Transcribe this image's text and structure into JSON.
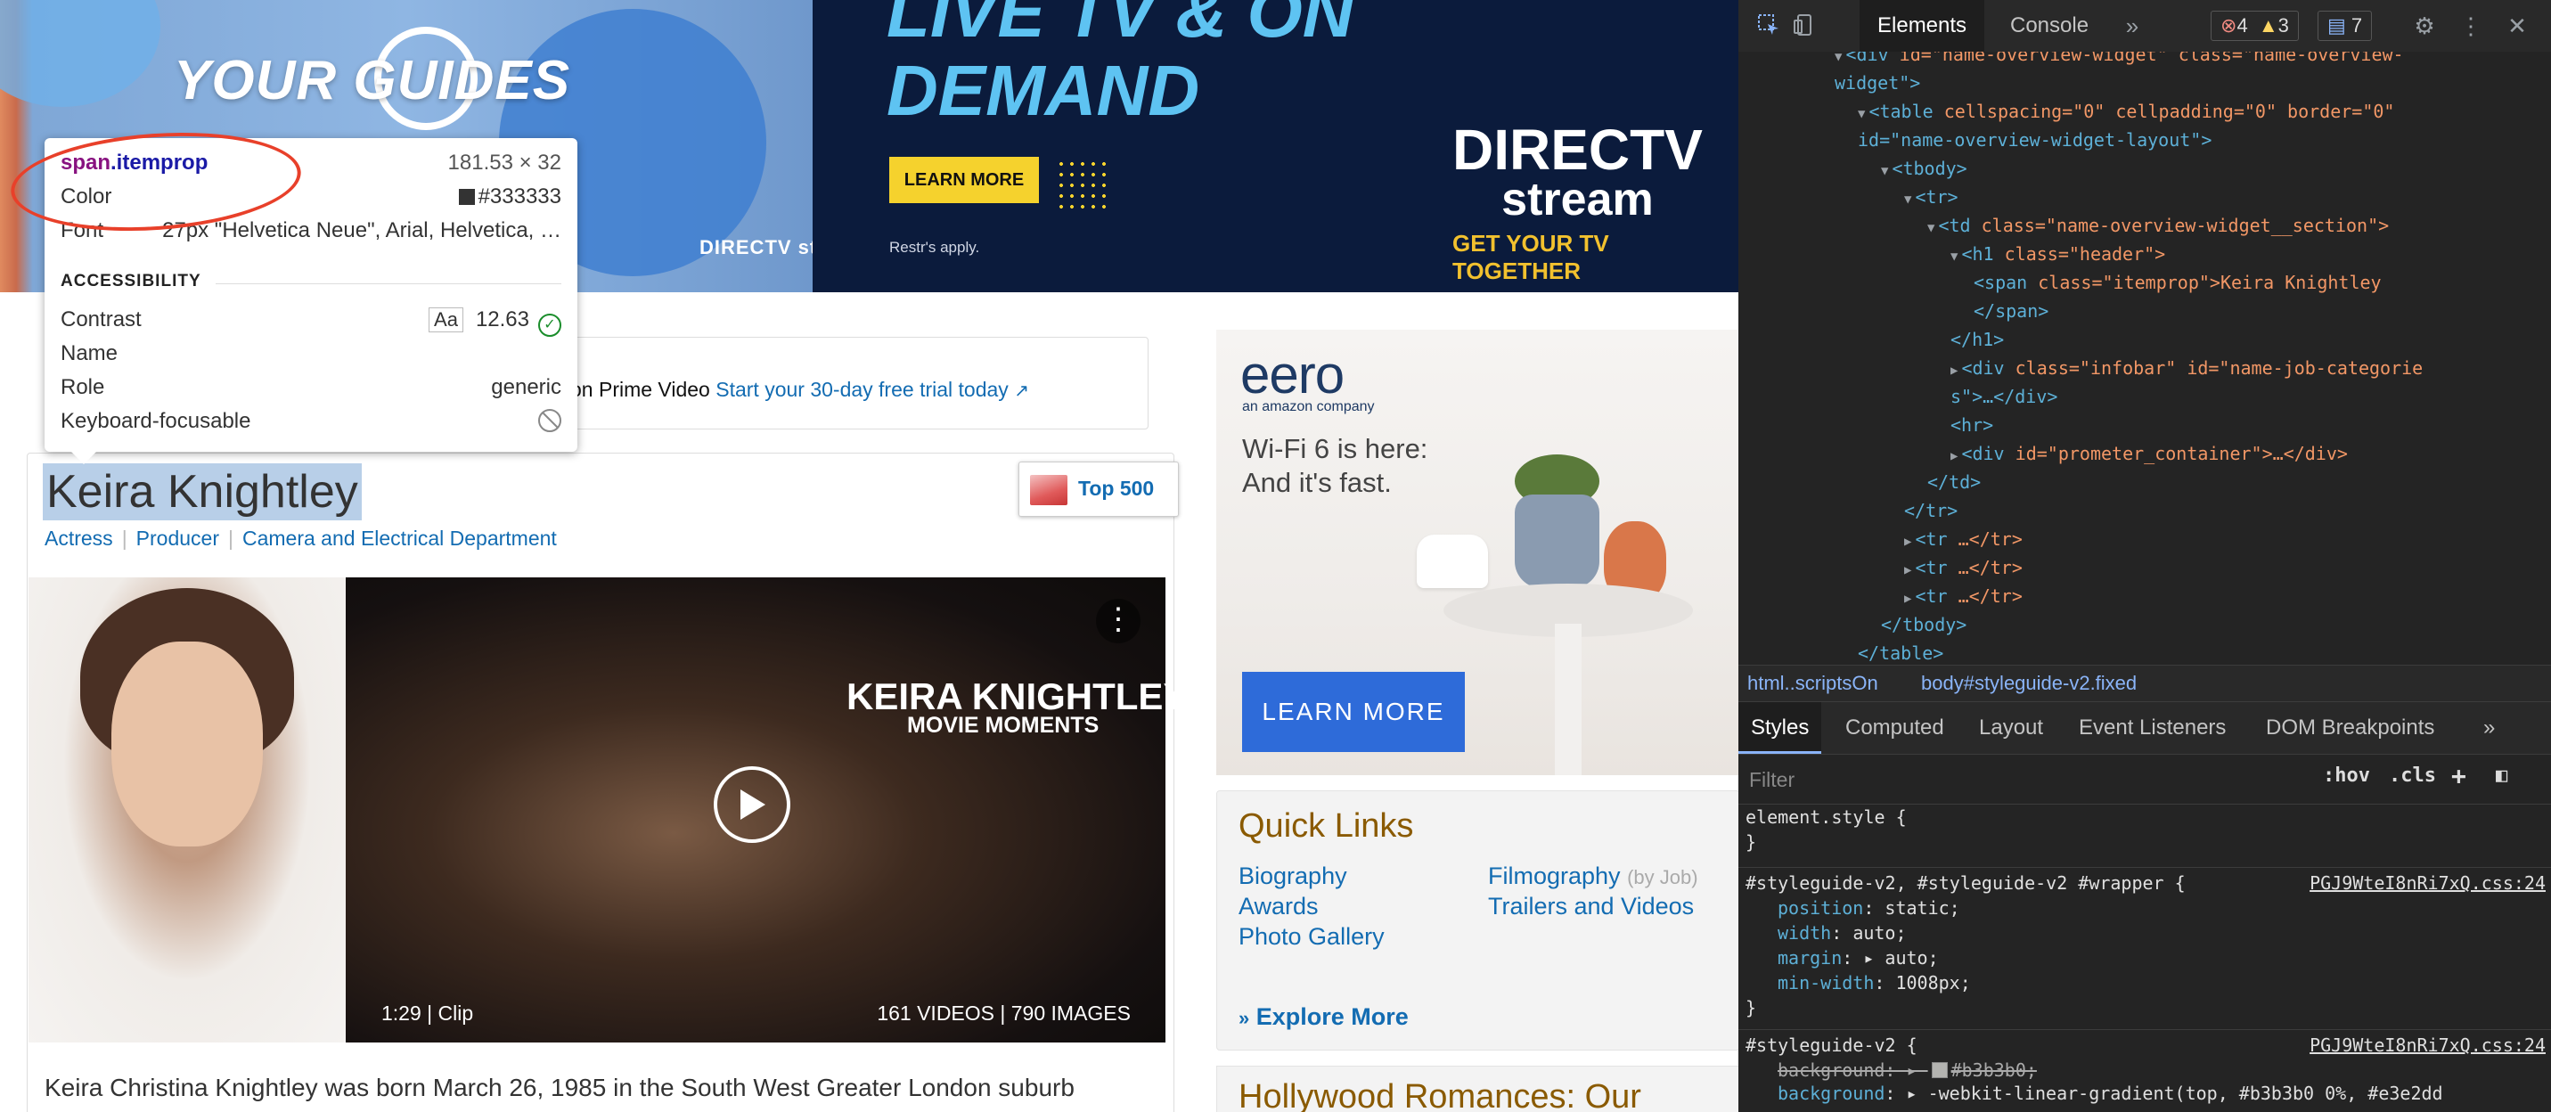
{
  "banner": {
    "left_brand": "YOUR GUIDES",
    "left_logo": "DIRECTV stream",
    "headline": "LIVE TV & ON DEMAND",
    "cta": "LEARN MORE",
    "restrictions": "Restr's apply.",
    "logo_line1": "DIRECTV",
    "logo_line2": "stream",
    "tagline": "GET YOUR TV TOGETHER"
  },
  "prime": {
    "text": "on Prime Video",
    "link": "Start your 30-day free trial today"
  },
  "profile": {
    "name": "Keira Knightley",
    "jobs": [
      "Actress",
      "Producer",
      "Camera and Electrical Department"
    ],
    "top_badge": "Top 500",
    "video_title": "KEIRA KNIGHTLEY",
    "video_subtitle": "MOVIE MOMENTS",
    "clip_info": "1:29 | Clip",
    "media_counts": "161 VIDEOS | 790 IMAGES",
    "bio": "Keira Christina Knightley was born March 26, 1985 in the South West Greater London suburb"
  },
  "tooltip": {
    "selector_tag": "span",
    "selector_class": ".itemprop",
    "size": "181.53 × 32",
    "color_label": "Color",
    "color_value": "#333333",
    "font_label": "Font",
    "font_value": "27px \"Helvetica Neue\", Arial, Helvetica, …",
    "accessibility_heading": "ACCESSIBILITY",
    "contrast_label": "Contrast",
    "contrast_aa": "Aa",
    "contrast_value": "12.63",
    "name_label": "Name",
    "role_label": "Role",
    "role_value": "generic",
    "focus_label": "Keyboard-focusable"
  },
  "sidebar": {
    "eero_logo": "eero",
    "eero_sub": "an amazon company",
    "eero_copy_1": "Wi-Fi 6 is here:",
    "eero_copy_2": "And it's fast.",
    "eero_cta": "LEARN MORE",
    "quick_links_title": "Quick Links",
    "links": {
      "biography": "Biography",
      "awards": "Awards",
      "photo_gallery": "Photo Gallery",
      "filmography": "Filmography",
      "by_job": "(by Job)",
      "trailers": "Trailers and Videos"
    },
    "explore_more": "Explore More",
    "next_title": "Hollywood Romances: Our"
  },
  "devtools": {
    "tabs": [
      "Elements",
      "Console"
    ],
    "errors": "4",
    "warnings": "3",
    "messages": "7",
    "dom_lines": [
      {
        "indent": 0,
        "tri": "▼",
        "tag": "div",
        "attrs": "id=\"name-overview-widget\" class=\"name-overview-"
      },
      {
        "indent": 0,
        "tri": "",
        "tag": "",
        "attrs": "widget\">"
      },
      {
        "indent": 1,
        "tri": "▼",
        "tag": "table",
        "attrs": "cellspacing=\"0\" cellpadding=\"0\" border=\"0\""
      },
      {
        "indent": 1,
        "tri": "",
        "tag": "",
        "attrs": "id=\"name-overview-widget-layout\">"
      },
      {
        "indent": 2,
        "tri": "▼",
        "tag": "tbody",
        "attrs": ""
      },
      {
        "indent": 3,
        "tri": "▼",
        "tag": "tr",
        "attrs": ""
      },
      {
        "indent": 4,
        "tri": "▼",
        "tag": "td",
        "attrs": "class=\"name-overview-widget__section\">"
      },
      {
        "indent": 5,
        "tri": "▼",
        "tag": "h1",
        "attrs": "class=\"header\">"
      },
      {
        "indent": 6,
        "tri": "",
        "tag": "span",
        "attrs": "class=\"itemprop\">Keira Knightley"
      },
      {
        "indent": 6,
        "tri": "",
        "tag": "",
        "attrs": "</span>"
      },
      {
        "indent": 5,
        "tri": "",
        "tag": "",
        "attrs": "</h1>"
      },
      {
        "indent": 5,
        "tri": "▶",
        "tag": "div",
        "attrs": "class=\"infobar\" id=\"name-job-categorie"
      },
      {
        "indent": 5,
        "tri": "",
        "tag": "",
        "attrs": "s\">…</div>"
      },
      {
        "indent": 5,
        "tri": "",
        "tag": "hr",
        "attrs": ""
      },
      {
        "indent": 5,
        "tri": "▶",
        "tag": "div",
        "attrs": "id=\"prometer_container\">…</div>"
      },
      {
        "indent": 4,
        "tri": "",
        "tag": "",
        "attrs": "</td>"
      },
      {
        "indent": 3,
        "tri": "",
        "tag": "",
        "attrs": "</tr>"
      },
      {
        "indent": 3,
        "tri": "▶",
        "tag": "tr",
        "attrs": "…</tr>"
      },
      {
        "indent": 3,
        "tri": "▶",
        "tag": "tr",
        "attrs": "…</tr>"
      },
      {
        "indent": 3,
        "tri": "▶",
        "tag": "tr",
        "attrs": "…</tr>"
      },
      {
        "indent": 2,
        "tri": "",
        "tag": "",
        "attrs": "</tbody>"
      },
      {
        "indent": 1,
        "tri": "",
        "tag": "",
        "attrs": "</table>"
      },
      {
        "indent": 0,
        "tri": "",
        "tag": "",
        "attrs": "</div>"
      }
    ],
    "breadcrumbs": [
      "html..scriptsOn",
      "body#styleguide-v2.fixed"
    ],
    "panel_tabs": [
      "Styles",
      "Computed",
      "Layout",
      "Event Listeners",
      "DOM Breakpoints"
    ],
    "filter_placeholder": "Filter",
    "hov": ":hov",
    "cls": ".cls",
    "css": {
      "element_style": "element.style {",
      "close": "}",
      "rule1_selector": "#styleguide-v2, #styleguide-v2 #wrapper {",
      "rule1_source": "PGJ9WteI8nRi7xQ.css:24",
      "rule1_props": [
        {
          "p": "position",
          "v": "static;"
        },
        {
          "p": "width",
          "v": "auto;"
        },
        {
          "p": "margin",
          "v": "▸ auto;"
        },
        {
          "p": "min-width",
          "v": "1008px;"
        }
      ],
      "rule2_selector": "#styleguide-v2 {",
      "rule2_source": "PGJ9WteI8nRi7xQ.css:24",
      "rule2_bg1": "#b3b3b0;",
      "rule2_bg2": "-webkit-linear-gradient(top, #b3b3b0 0%, #e3e2dd"
    }
  }
}
